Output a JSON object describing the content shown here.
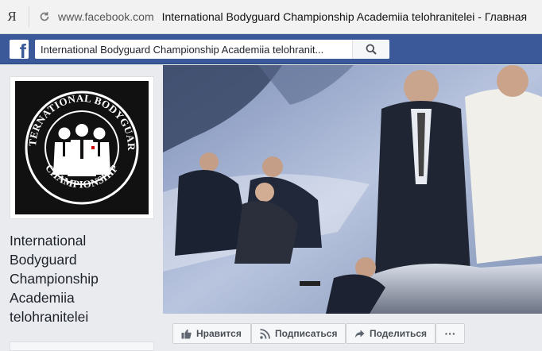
{
  "browser": {
    "logo_glyph": "Я",
    "domain": "www.facebook.com",
    "title": "International Bodyguard Championship Academiia telohranitelei - Главная"
  },
  "facebook": {
    "logo_letter": "f",
    "search_value": "International Bodyguard Championship Academiia telohranit...",
    "search_icon": "search-icon"
  },
  "page": {
    "name": "International Bodyguard Championship Academiia telohranitelei",
    "logo_text_top": "INTERNATIONAL BODYGUARD",
    "logo_text_bottom": "CHAMPIONSHIP"
  },
  "actions": {
    "like": "Нравится",
    "follow": "Подписаться",
    "share": "Поделиться",
    "more": "···"
  },
  "colors": {
    "facebook_blue": "#3b5998",
    "page_bg": "#e9ebee"
  }
}
